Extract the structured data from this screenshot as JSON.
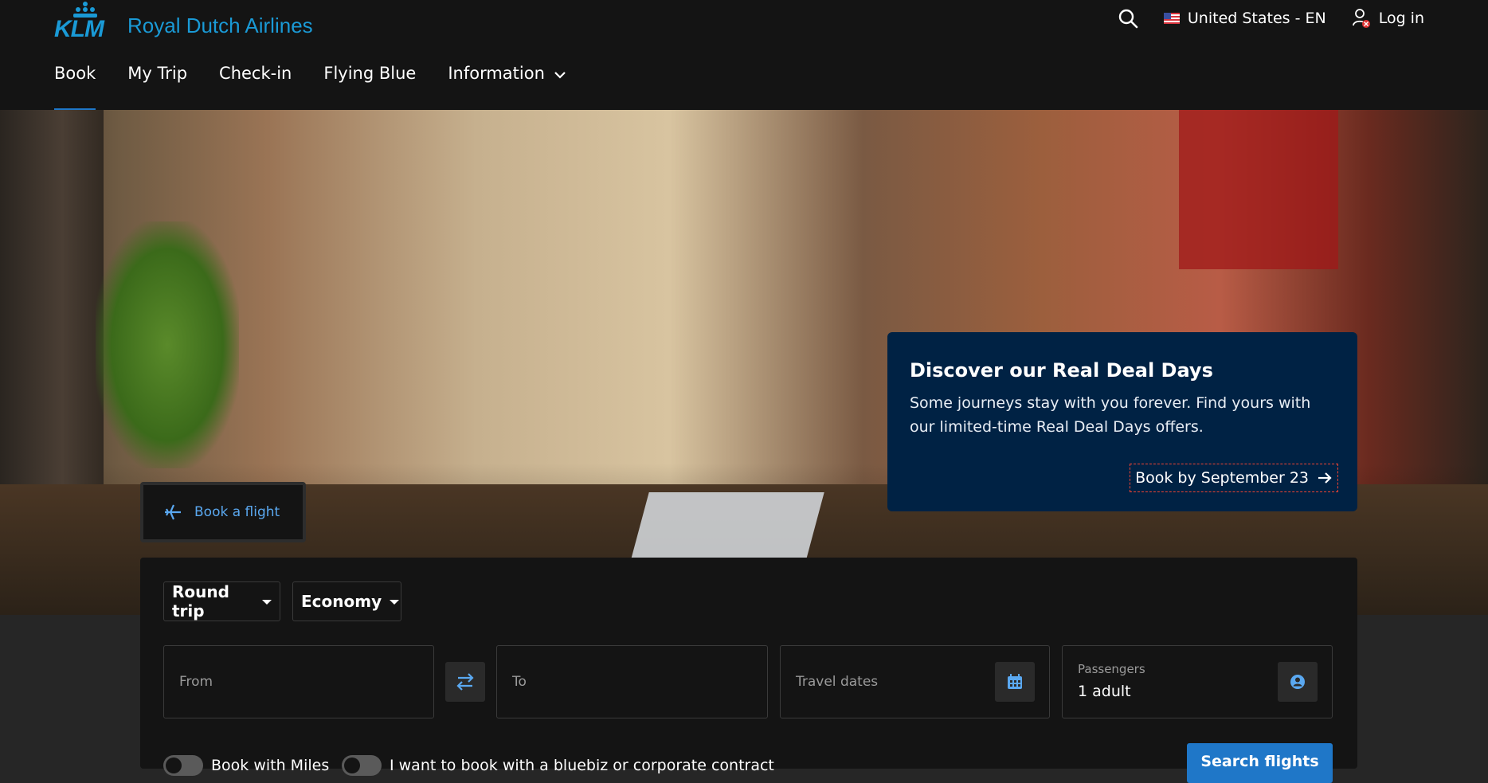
{
  "brand": {
    "logo_text": "KLM",
    "name": "Royal Dutch Airlines",
    "color": "#1a9ad6"
  },
  "utility": {
    "region": "United States - EN",
    "login": "Log in"
  },
  "nav": {
    "items": [
      "Book",
      "My Trip",
      "Check-in",
      "Flying Blue",
      "Information"
    ],
    "active": "Book"
  },
  "promo": {
    "title": "Discover our Real Deal Days",
    "body": "Some journeys stay with you forever. Find yours with our limited-time Real Deal Days offers.",
    "link": "Book by September 23"
  },
  "booking": {
    "tab_label": "Book a flight",
    "trip_type": "Round trip",
    "cabin": "Economy",
    "from_placeholder": "From",
    "to_placeholder": "To",
    "dates_placeholder": "Travel dates",
    "passengers_label": "Passengers",
    "passengers_value": "1 adult",
    "miles_toggle": "Book with Miles",
    "corporate_toggle": "I want to book with a bluebiz or corporate contract",
    "search_button": "Search flights"
  },
  "colors": {
    "accent": "#1f77c8",
    "promo_bg": "#002244",
    "header_bg": "#141414"
  }
}
